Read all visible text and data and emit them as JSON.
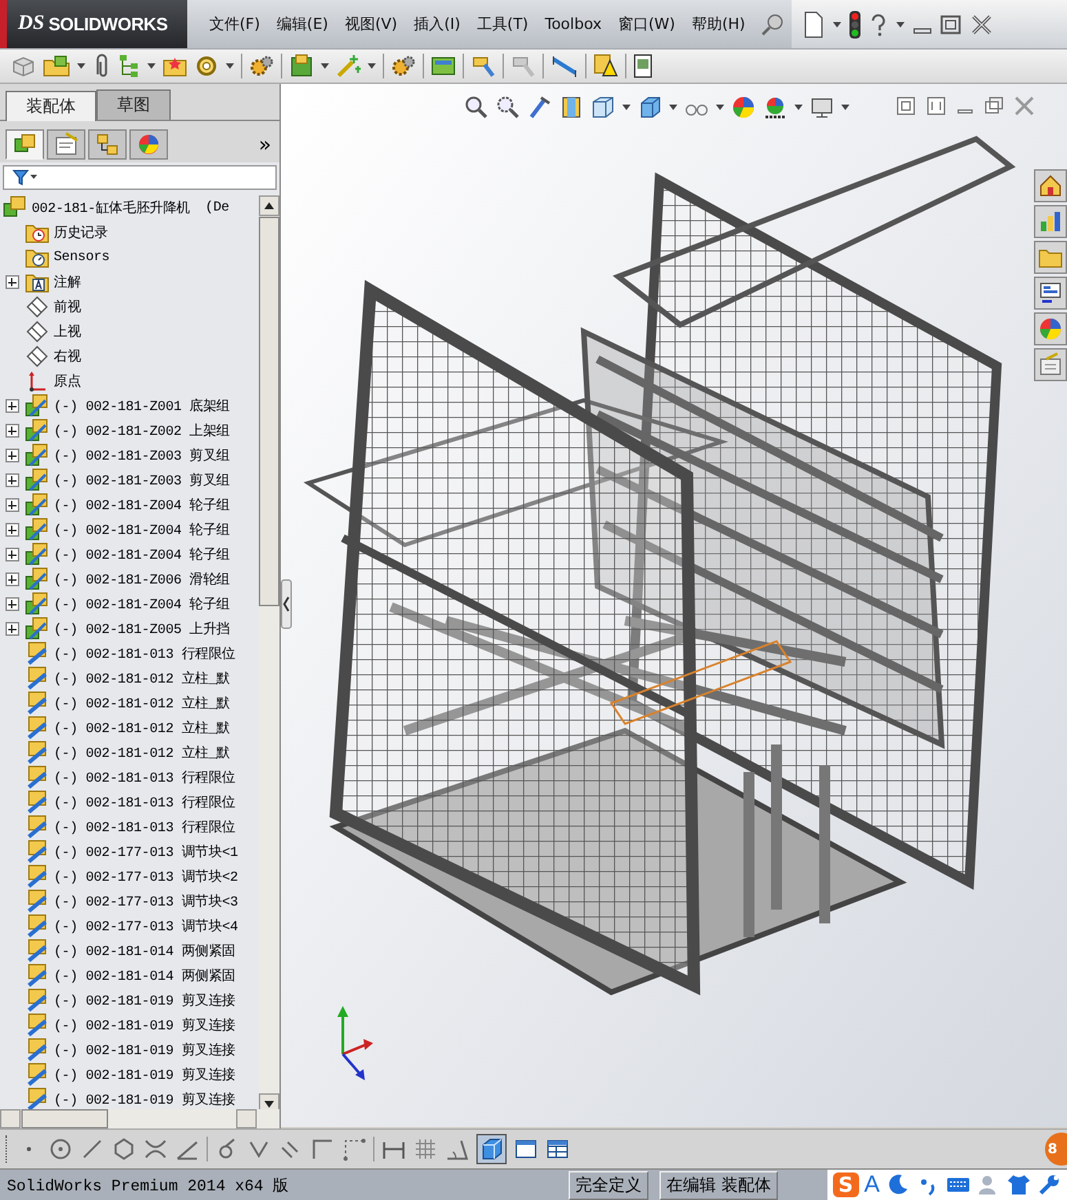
{
  "app": {
    "mark": "DS",
    "name": "SOLIDWORKS"
  },
  "menu": [
    {
      "label": "文件(F)"
    },
    {
      "label": "编辑(E)"
    },
    {
      "label": "视图(V)"
    },
    {
      "label": "插入(I)"
    },
    {
      "label": "工具(T)"
    },
    {
      "label": "Toolbox"
    },
    {
      "label": "窗口(W)"
    },
    {
      "label": "帮助(H)"
    }
  ],
  "feature_tabs": [
    {
      "label": "装配体",
      "selected": true
    },
    {
      "label": "草图",
      "selected": false
    }
  ],
  "manager_tabs": [
    {
      "kind": "feature",
      "selected": true
    },
    {
      "kind": "property",
      "selected": false
    },
    {
      "kind": "config",
      "selected": false
    },
    {
      "kind": "display",
      "selected": false
    }
  ],
  "more": "»",
  "tree": {
    "root": {
      "label": "002-181-缸体毛胚升降机",
      "suffix": "(De"
    },
    "items": [
      {
        "kind": "history",
        "label": "历史记录"
      },
      {
        "kind": "sensors",
        "label": "Sensors"
      },
      {
        "kind": "annotation",
        "label": "注解",
        "expanded": false
      },
      {
        "kind": "plane",
        "label": "前视"
      },
      {
        "kind": "plane",
        "label": "上视"
      },
      {
        "kind": "plane",
        "label": "右视"
      },
      {
        "kind": "origin",
        "label": "原点"
      },
      {
        "kind": "assembly",
        "label": "(-) 002-181-Z001 底架组",
        "expanded": false
      },
      {
        "kind": "assembly",
        "label": "(-) 002-181-Z002 上架组",
        "expanded": false
      },
      {
        "kind": "assembly",
        "label": "(-) 002-181-Z003 剪叉组",
        "expanded": false
      },
      {
        "kind": "assembly",
        "label": "(-) 002-181-Z003 剪叉组",
        "expanded": false
      },
      {
        "kind": "assembly",
        "label": "(-) 002-181-Z004 轮子组",
        "expanded": false
      },
      {
        "kind": "assembly",
        "label": "(-) 002-181-Z004 轮子组",
        "expanded": false
      },
      {
        "kind": "assembly",
        "label": "(-) 002-181-Z004 轮子组",
        "expanded": false
      },
      {
        "kind": "assembly",
        "label": "(-) 002-181-Z006 滑轮组",
        "expanded": false
      },
      {
        "kind": "assembly",
        "label": "(-) 002-181-Z004 轮子组",
        "expanded": false
      },
      {
        "kind": "assembly",
        "label": "(-) 002-181-Z005 上升挡",
        "expanded": false
      },
      {
        "kind": "part",
        "label": "(-) 002-181-013 行程限位"
      },
      {
        "kind": "part",
        "label": "(-) 002-181-012 立柱_默"
      },
      {
        "kind": "part",
        "label": "(-) 002-181-012 立柱_默"
      },
      {
        "kind": "part",
        "label": "(-) 002-181-012 立柱_默"
      },
      {
        "kind": "part",
        "label": "(-) 002-181-012 立柱_默"
      },
      {
        "kind": "part",
        "label": "(-) 002-181-013 行程限位"
      },
      {
        "kind": "part",
        "label": "(-) 002-181-013 行程限位"
      },
      {
        "kind": "part",
        "label": "(-) 002-181-013 行程限位"
      },
      {
        "kind": "part",
        "label": "(-) 002-177-013 调节块<1"
      },
      {
        "kind": "part",
        "label": "(-) 002-177-013 调节块<2"
      },
      {
        "kind": "part",
        "label": "(-) 002-177-013 调节块<3"
      },
      {
        "kind": "part",
        "label": "(-) 002-177-013 调节块<4"
      },
      {
        "kind": "part",
        "label": "(-) 002-181-014 两侧紧固"
      },
      {
        "kind": "part",
        "label": "(-) 002-181-014 两侧紧固"
      },
      {
        "kind": "part",
        "label": "(-) 002-181-019 剪叉连接"
      },
      {
        "kind": "part",
        "label": "(-) 002-181-019 剪叉连接"
      },
      {
        "kind": "part",
        "label": "(-) 002-181-019 剪叉连接"
      },
      {
        "kind": "part",
        "label": "(-) 002-181-019 剪叉连接"
      },
      {
        "kind": "part",
        "label": "(-) 002-181-019 剪叉连接"
      }
    ]
  },
  "status": {
    "product": "SolidWorks Premium 2014 x64 版",
    "definition": "完全定义",
    "mode": "在编辑 装配体"
  },
  "ime": {
    "logo": "S",
    "lang": "A"
  },
  "badge": "8"
}
